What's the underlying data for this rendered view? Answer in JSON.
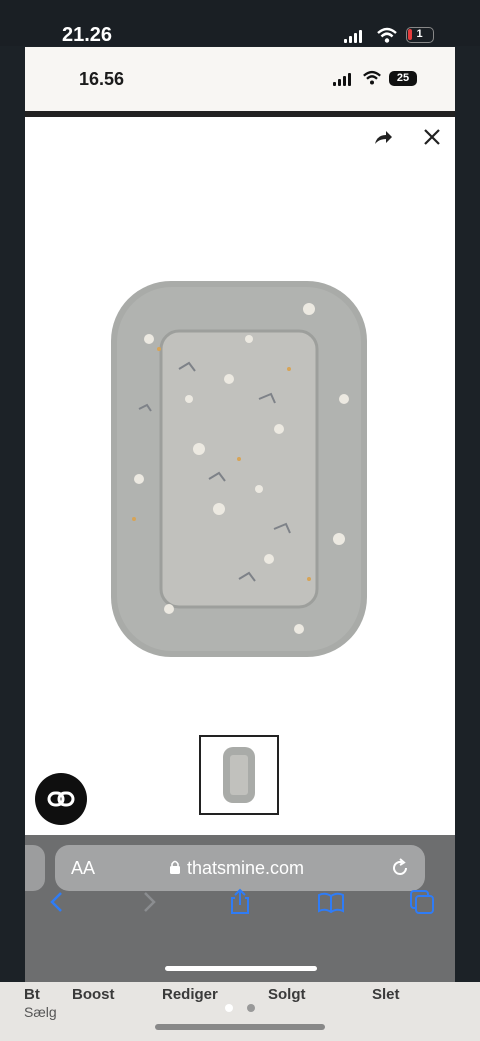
{
  "outer_status": {
    "time": "21.26",
    "battery": "1"
  },
  "inner_status": {
    "time": "16.56",
    "battery": "25"
  },
  "browser": {
    "text_size_button": "AA",
    "url": "thatsmine.com"
  },
  "background_page": {
    "labels": [
      "Boost",
      "Rediger",
      "Solgt",
      "Slet"
    ],
    "partial_left_title": "Bt",
    "partial_left_sub": "Sælg"
  },
  "product": {
    "image_name": "baby-nest-product-image"
  },
  "colors": {
    "safari_link": "#2f7cf6",
    "nest_gray": "#a9aba8"
  }
}
